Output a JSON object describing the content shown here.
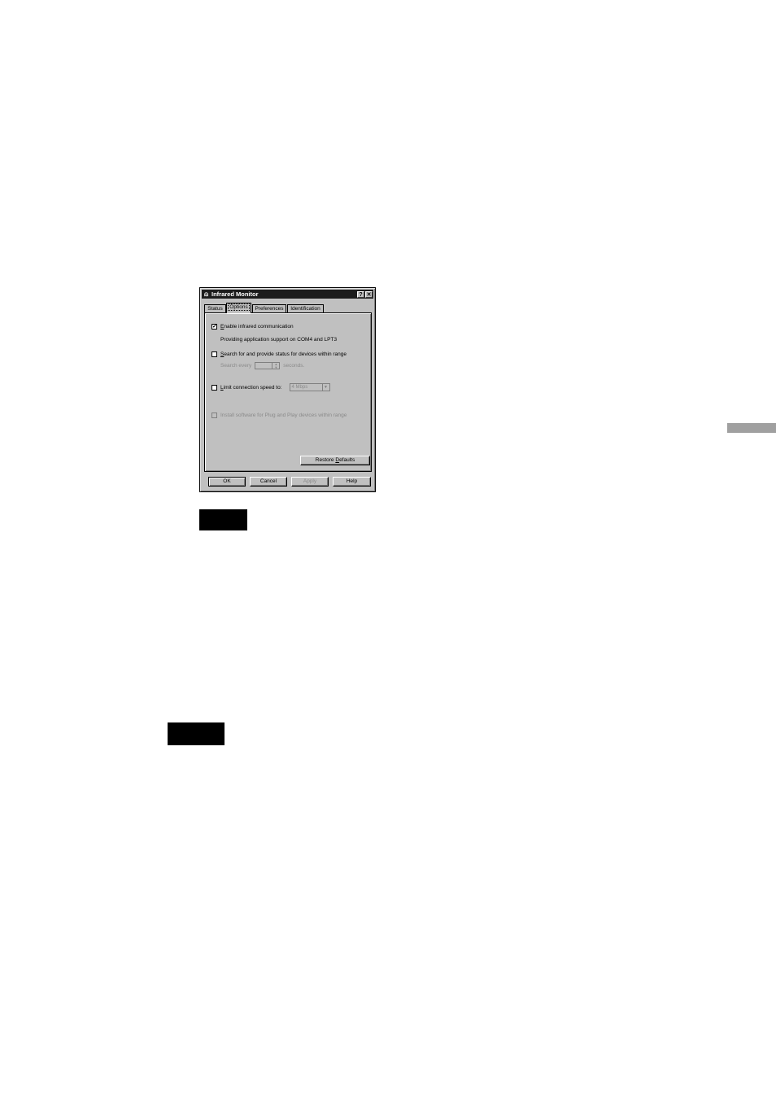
{
  "dialog": {
    "title": "Infrared Monitor",
    "help_button": "?",
    "close_button": "✕",
    "tabs": [
      {
        "label": "Status"
      },
      {
        "label": "Options"
      },
      {
        "label": "Preferences"
      },
      {
        "label": "Identification"
      }
    ],
    "active_tab": "Options",
    "options": {
      "enable": {
        "checked": true,
        "hotkey": "E",
        "rest": "nable infrared communication"
      },
      "support_text": "Providing application support on COM4 and LPT3",
      "search": {
        "checked": false,
        "hotkey": "S",
        "rest": "earch for and provide status for devices within range"
      },
      "search_every_label": "Search every",
      "search_every_value": "",
      "seconds_label": "seconds.",
      "limit": {
        "checked": false,
        "hotkey": "L",
        "rest": "imit connection speed to:"
      },
      "speed_value": "4 Mbps",
      "install": {
        "checked": false,
        "label": "Install software for Plug and Play devices within range"
      },
      "restore_label_pre": "Restore ",
      "restore_hotkey": "D",
      "restore_label_post": "efaults"
    },
    "buttons": {
      "ok": "OK",
      "cancel": "Cancel",
      "apply": "Apply",
      "help": "Help"
    }
  }
}
